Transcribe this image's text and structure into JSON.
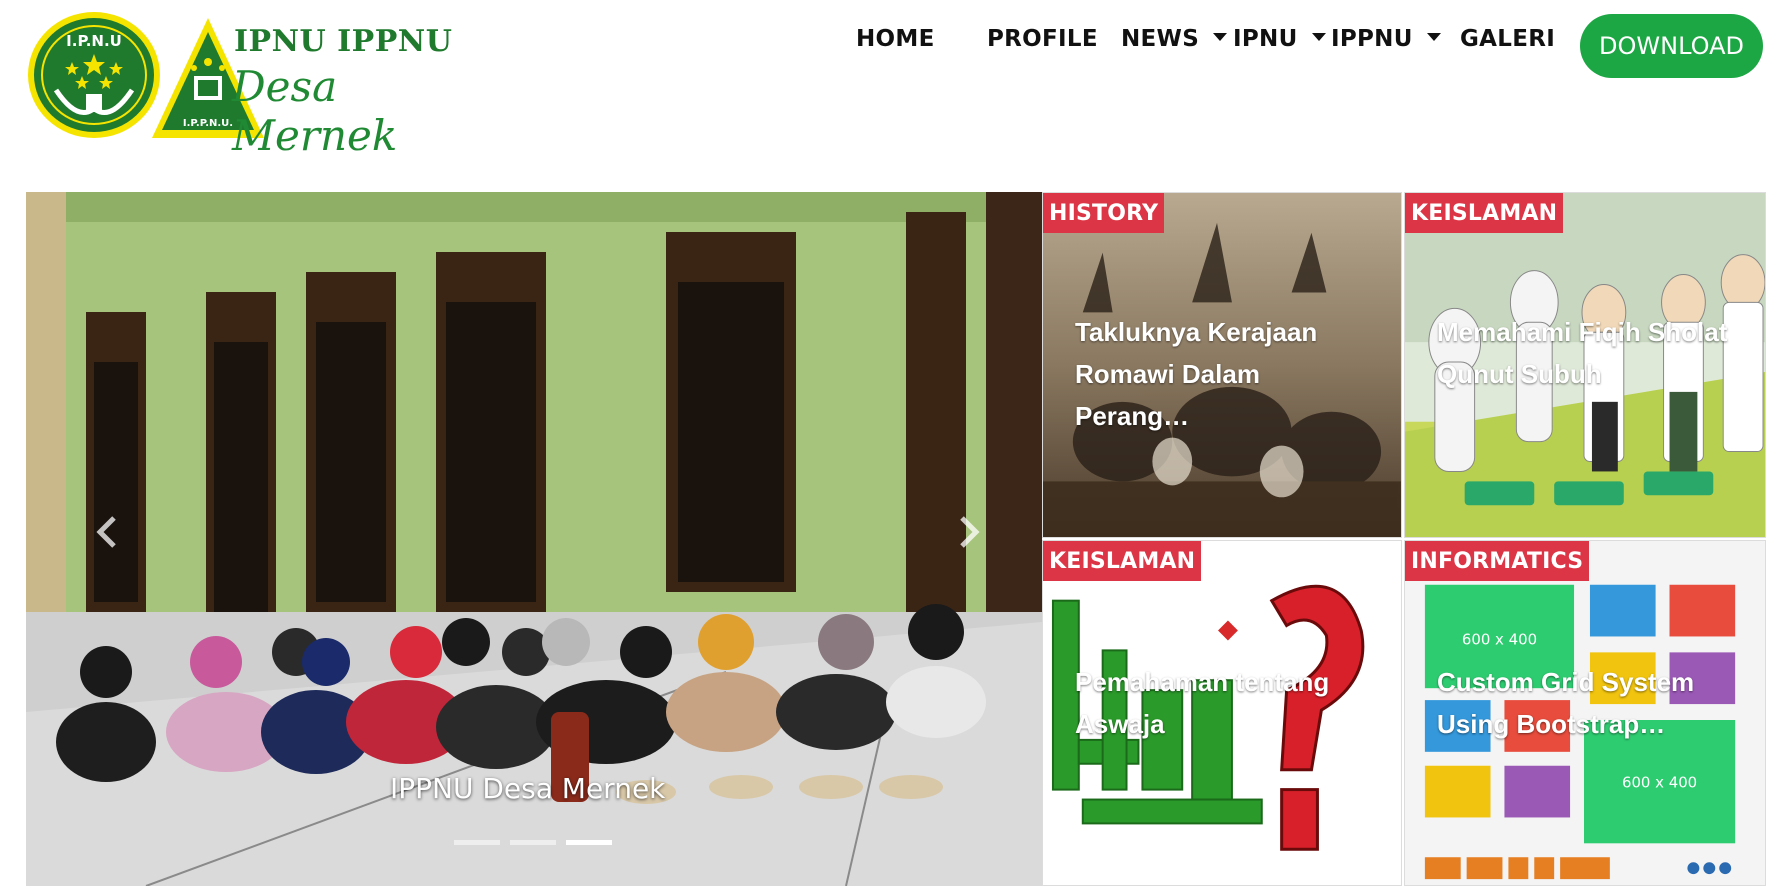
{
  "brand": {
    "line1": "IPNU IPPNU",
    "line2": "Desa Mernek",
    "ipnu_badge_text": "I.P.N.U",
    "ippnu_badge_text": "I.P.P.N.U.",
    "green": "#1f7a2e",
    "yellow": "#f5e400"
  },
  "nav": {
    "items": [
      {
        "label": "HOME",
        "dropdown": false
      },
      {
        "label": "PROFILE",
        "dropdown": false
      },
      {
        "label": "NEWS",
        "dropdown": true
      },
      {
        "label": "IPNU",
        "dropdown": true
      },
      {
        "label": "IPPNU",
        "dropdown": true
      },
      {
        "label": "GALERI",
        "dropdown": false
      }
    ],
    "download_label": "DOWNLOAD",
    "download_color": "#1ca744"
  },
  "carousel": {
    "caption": "IPPNU Desa Mernek",
    "slide_count": 3,
    "active_index": 2,
    "prev_icon": "chevron-left-icon",
    "next_icon": "chevron-right-icon"
  },
  "cards": [
    {
      "category": "HISTORY",
      "title": "Takluknya Kerajaan Romawi Dalam Perang…"
    },
    {
      "category": "KEISLAMAN",
      "title": "Memahami Fiqih Sholat Qunut Subuh"
    },
    {
      "category": "KEISLAMAN",
      "title": "Pemahaman tentang Aswaja"
    },
    {
      "category": "INFORMATICS",
      "title": "Custom Grid System Using Bootstrap…"
    }
  ],
  "colors": {
    "badge": "#dc3545"
  }
}
